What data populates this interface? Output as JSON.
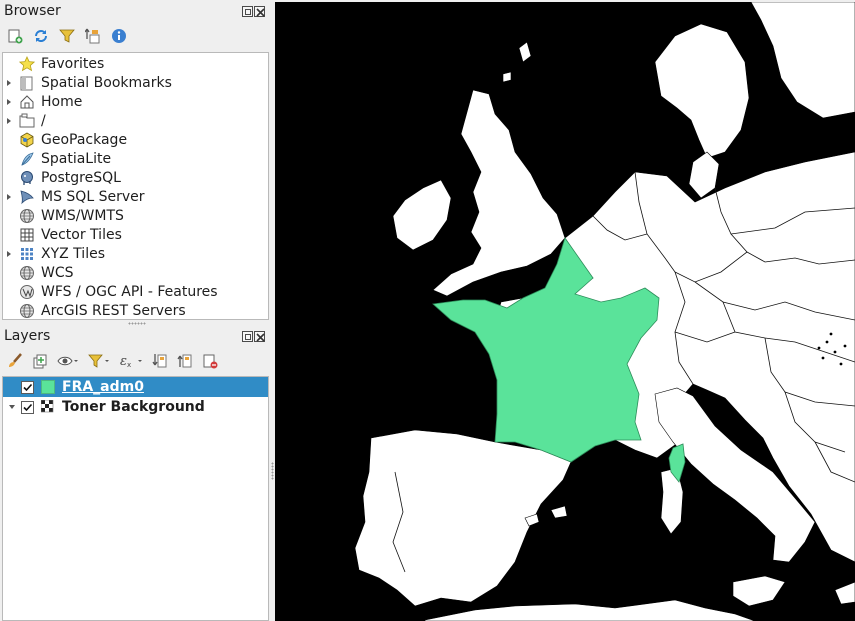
{
  "browser": {
    "title": "Browser",
    "toolbar": [
      {
        "icon": "add-layer-icon"
      },
      {
        "icon": "refresh-icon"
      },
      {
        "icon": "filter-icon"
      },
      {
        "icon": "collapse-all-icon"
      },
      {
        "icon": "info-icon"
      }
    ],
    "items": [
      {
        "label": "Favorites",
        "icon": "star-icon",
        "expandable": false
      },
      {
        "label": "Spatial Bookmarks",
        "icon": "bookmark-icon",
        "expandable": true
      },
      {
        "label": "Home",
        "icon": "home-icon",
        "expandable": true
      },
      {
        "label": "/",
        "icon": "folder-icon",
        "expandable": true
      },
      {
        "label": "GeoPackage",
        "icon": "geopackage-icon",
        "expandable": false
      },
      {
        "label": "SpatiaLite",
        "icon": "spatialite-icon",
        "expandable": false
      },
      {
        "label": "PostgreSQL",
        "icon": "postgresql-icon",
        "expandable": false
      },
      {
        "label": "MS SQL Server",
        "icon": "mssql-icon",
        "expandable": true
      },
      {
        "label": "WMS/WMTS",
        "icon": "globe-icon",
        "expandable": false
      },
      {
        "label": "Vector Tiles",
        "icon": "grid-icon",
        "expandable": false
      },
      {
        "label": "XYZ Tiles",
        "icon": "tiles-icon",
        "expandable": true
      },
      {
        "label": "WCS",
        "icon": "globe-icon",
        "expandable": false
      },
      {
        "label": "WFS / OGC API - Features",
        "icon": "wfs-icon",
        "expandable": false
      },
      {
        "label": "ArcGIS REST Servers",
        "icon": "globe-icon",
        "expandable": false
      }
    ]
  },
  "layers": {
    "title": "Layers",
    "toolbar": [
      {
        "icon": "paintbrush-icon"
      },
      {
        "icon": "add-group-icon"
      },
      {
        "icon": "eye-icon"
      },
      {
        "icon": "filter-icon"
      },
      {
        "icon": "expression-filter-icon"
      },
      {
        "icon": "expand-all-icon"
      },
      {
        "icon": "collapse-all-icon"
      },
      {
        "icon": "remove-layer-icon"
      }
    ],
    "items": [
      {
        "name": "FRA_adm0",
        "checked": true,
        "selected": true,
        "swatch": "#5ae39a"
      },
      {
        "name": "Toner Background",
        "checked": true,
        "selected": false
      }
    ]
  },
  "map": {
    "background": "#000000",
    "land_color": "#ffffff",
    "highlight_color": "#5ae39a",
    "highlight_feature": "France"
  }
}
